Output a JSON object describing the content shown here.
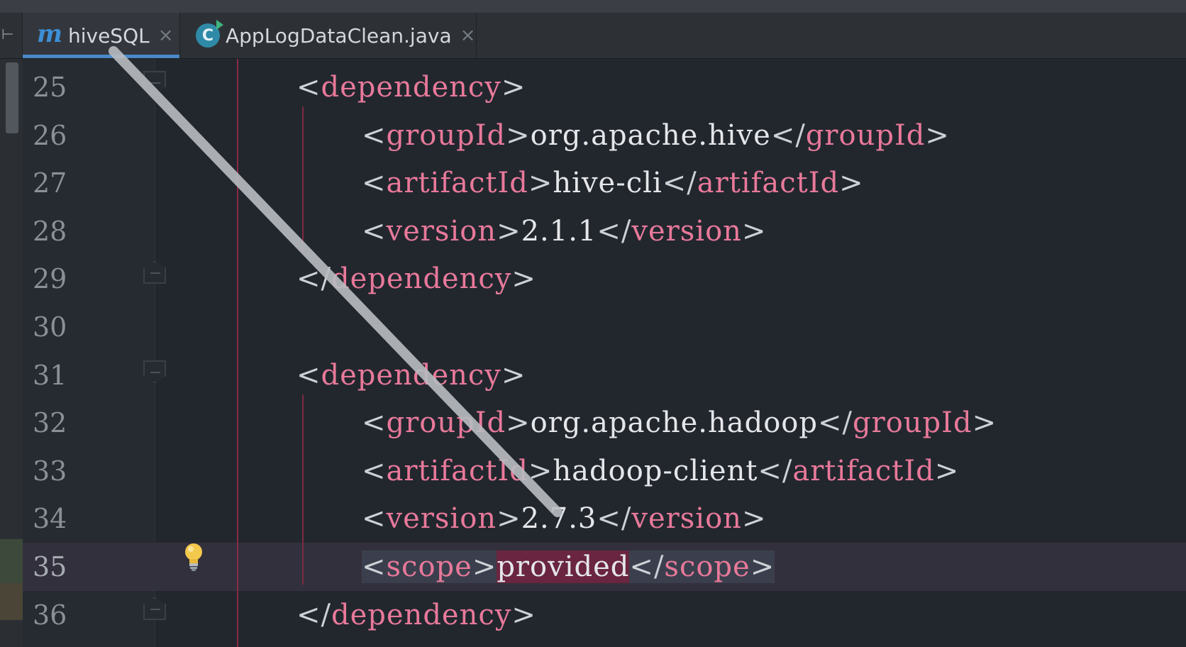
{
  "tabs": [
    {
      "label": "hiveSQL",
      "icon": "maven-m-icon",
      "active": true
    },
    {
      "label": "AppLogDataClean.java",
      "icon": "java-class-icon",
      "active": false
    }
  ],
  "tab_edge_glyph": "⊢",
  "tab_close_glyph": "×",
  "lines": [
    {
      "num": "25",
      "indent": 1,
      "tokens": [
        [
          "br",
          "<"
        ],
        [
          "tag",
          "dependency"
        ],
        [
          "br",
          ">"
        ]
      ]
    },
    {
      "num": "26",
      "indent": 2,
      "tokens": [
        [
          "br",
          "<"
        ],
        [
          "tag",
          "groupId"
        ],
        [
          "br",
          ">"
        ],
        [
          "txt",
          "org.apache.hive"
        ],
        [
          "br",
          "</"
        ],
        [
          "tag",
          "groupId"
        ],
        [
          "br",
          ">"
        ]
      ]
    },
    {
      "num": "27",
      "indent": 2,
      "tokens": [
        [
          "br",
          "<"
        ],
        [
          "tag",
          "artifactId"
        ],
        [
          "br",
          ">"
        ],
        [
          "txt",
          "hive-cli"
        ],
        [
          "br",
          "</"
        ],
        [
          "tag",
          "artifactId"
        ],
        [
          "br",
          ">"
        ]
      ]
    },
    {
      "num": "28",
      "indent": 2,
      "tokens": [
        [
          "br",
          "<"
        ],
        [
          "tag",
          "version"
        ],
        [
          "br",
          ">"
        ],
        [
          "txt",
          "2.1.1"
        ],
        [
          "br",
          "</"
        ],
        [
          "tag",
          "version"
        ],
        [
          "br",
          ">"
        ]
      ]
    },
    {
      "num": "29",
      "indent": 1,
      "tokens": [
        [
          "br",
          "</"
        ],
        [
          "tag",
          "dependency"
        ],
        [
          "br",
          ">"
        ]
      ]
    },
    {
      "num": "30",
      "indent": 1,
      "tokens": []
    },
    {
      "num": "31",
      "indent": 1,
      "tokens": [
        [
          "br",
          "<"
        ],
        [
          "tag",
          "dependency"
        ],
        [
          "br",
          ">"
        ]
      ]
    },
    {
      "num": "32",
      "indent": 2,
      "tokens": [
        [
          "br",
          "<"
        ],
        [
          "tag",
          "groupId"
        ],
        [
          "br",
          ">"
        ],
        [
          "txt",
          "org.apache.hadoop"
        ],
        [
          "br",
          "</"
        ],
        [
          "tag",
          "groupId"
        ],
        [
          "br",
          ">"
        ]
      ]
    },
    {
      "num": "33",
      "indent": 2,
      "tokens": [
        [
          "br",
          "<"
        ],
        [
          "tag",
          "artifactId"
        ],
        [
          "br",
          ">"
        ],
        [
          "txt",
          "hadoop-client"
        ],
        [
          "br",
          "</"
        ],
        [
          "tag",
          "artifactId"
        ],
        [
          "br",
          ">"
        ]
      ]
    },
    {
      "num": "34",
      "indent": 2,
      "tokens": [
        [
          "br",
          "<"
        ],
        [
          "tag",
          "version"
        ],
        [
          "br",
          ">"
        ],
        [
          "txt",
          "2.7.3"
        ],
        [
          "br",
          "</"
        ],
        [
          "tag",
          "version"
        ],
        [
          "br",
          ">"
        ]
      ]
    },
    {
      "num": "35",
      "indent": 2,
      "current": true,
      "tokens": [
        [
          "br",
          "<"
        ],
        [
          "tag",
          "scope"
        ],
        [
          "br",
          ">"
        ],
        [
          "txt",
          "provided"
        ],
        [
          "br",
          "</"
        ],
        [
          "tag",
          "scope"
        ],
        [
          "br",
          ">"
        ]
      ]
    },
    {
      "num": "36",
      "indent": 1,
      "tokens": [
        [
          "br",
          "</"
        ],
        [
          "tag",
          "dependency"
        ],
        [
          "br",
          ">"
        ]
      ]
    }
  ],
  "colors": {
    "tag": "#e8799a",
    "text": "#e4e6e9",
    "bracket": "#cdd1d6",
    "background": "#22272e",
    "current_line": "#33303d",
    "ruler": "#8a2a45"
  },
  "intention_icon": "lightbulb-icon"
}
